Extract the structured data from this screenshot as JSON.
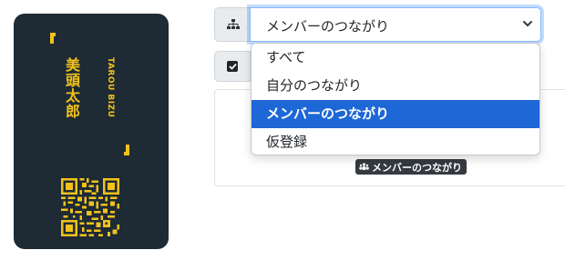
{
  "card": {
    "name_vertical": "美頭太郎",
    "romaji": "TAROU BIZU",
    "bg_color": "#1e2b35",
    "accent_color": "#f2c21b"
  },
  "filter": {
    "icon": "sitemap-icon",
    "selected": "メンバーのつながり",
    "options": [
      "すべて",
      "自分のつながり",
      "メンバーのつながり",
      "仮登録"
    ],
    "selected_index": 2
  },
  "checkbox": {
    "icon": "checkbox-checked-icon",
    "checked": true
  },
  "badge": {
    "icon": "users-icon",
    "label": "メンバーのつながり"
  }
}
